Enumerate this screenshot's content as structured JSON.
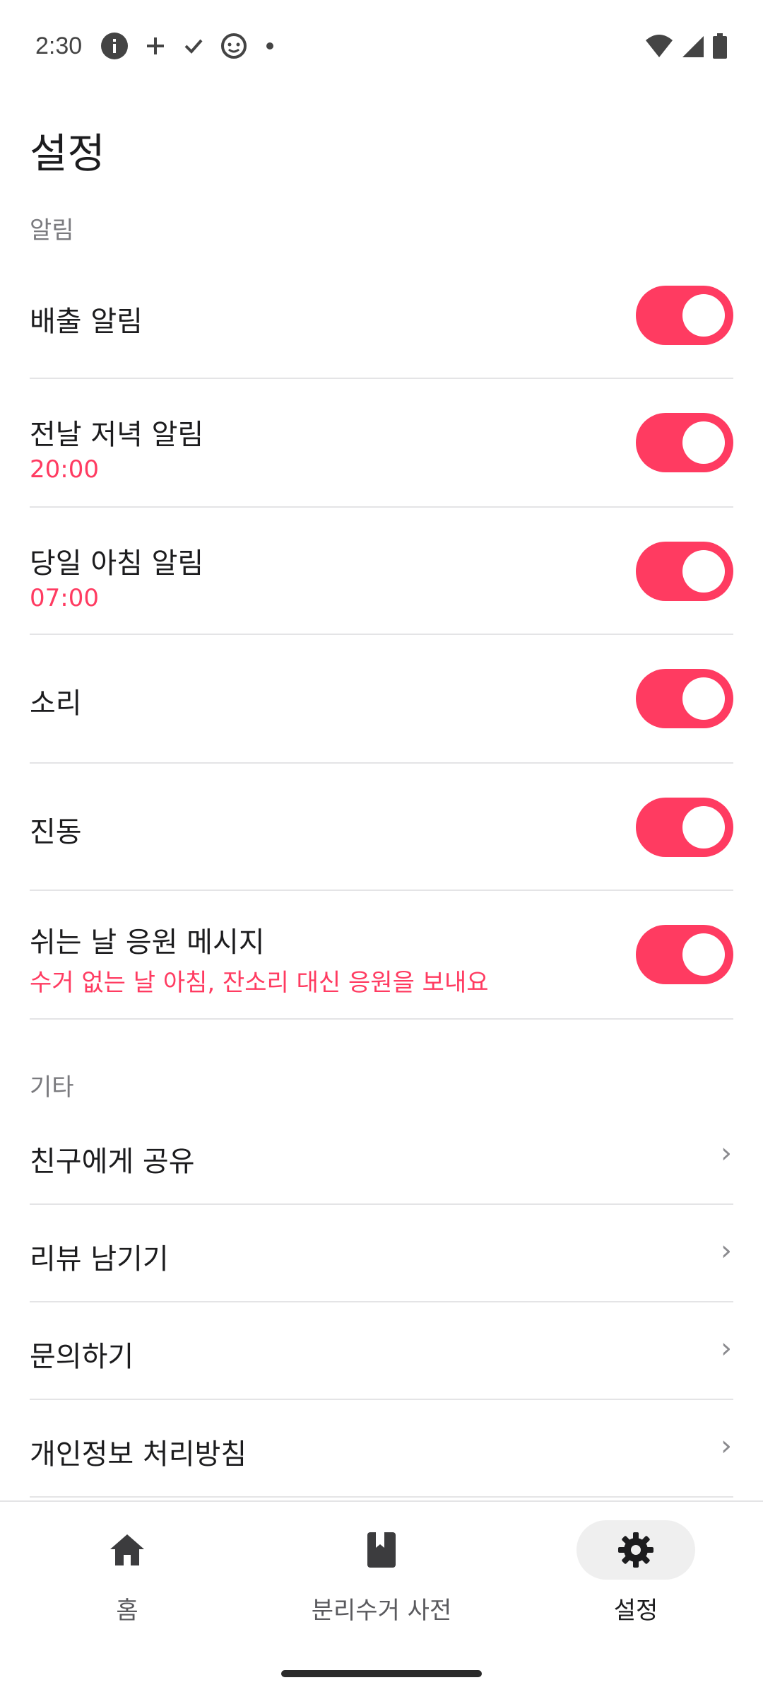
{
  "status_bar": {
    "time": "2:30"
  },
  "title": "설정",
  "sections": {
    "alarm_label": "알림",
    "other_label": "기타"
  },
  "alarm_items": [
    {
      "label": "배출 알림",
      "sub": "",
      "enabled": true
    },
    {
      "label": "전날 저녁 알림",
      "sub": "20:00",
      "enabled": true
    },
    {
      "label": "당일 아침 알림",
      "sub": "07:00",
      "enabled": true
    },
    {
      "label": "소리",
      "sub": "",
      "enabled": true
    },
    {
      "label": "진동",
      "sub": "",
      "enabled": true
    },
    {
      "label": "쉬는 날 응원 메시지",
      "sub": "수거 없는 날 아침, 잔소리 대신 응원을 보내요",
      "enabled": true
    }
  ],
  "other_items": [
    {
      "label": "친구에게 공유"
    },
    {
      "label": "리뷰 남기기"
    },
    {
      "label": "문의하기"
    },
    {
      "label": "개인정보 처리방침"
    }
  ],
  "chevron": "›",
  "bottom_nav": [
    {
      "label": "홈",
      "icon": "home-icon",
      "active": false
    },
    {
      "label": "분리수거 사전",
      "icon": "book-icon",
      "active": false
    },
    {
      "label": "설정",
      "icon": "gear-icon",
      "active": true
    }
  ],
  "colors": {
    "accent": "#ff3b61",
    "divider": "#e4e4e6"
  }
}
